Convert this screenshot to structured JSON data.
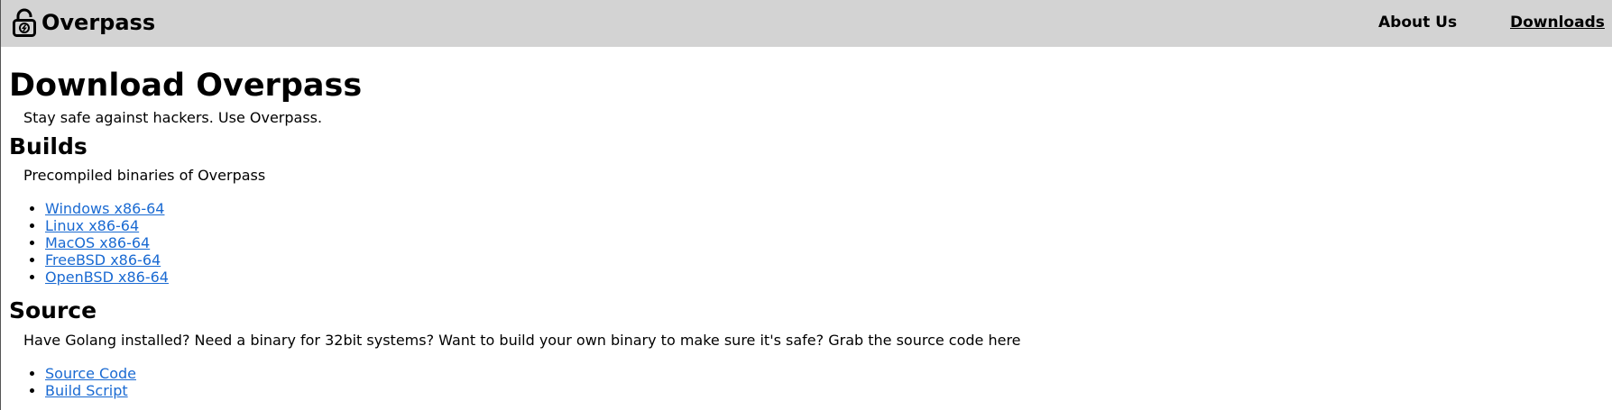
{
  "nav": {
    "brand": "Overpass",
    "links": [
      {
        "label": "About Us"
      },
      {
        "label": "Downloads"
      }
    ]
  },
  "main": {
    "title": "Download Overpass",
    "subtitle": "Stay safe against hackers. Use Overpass.",
    "builds": {
      "heading": "Builds",
      "description": "Precompiled binaries of Overpass",
      "links": [
        "Windows x86-64",
        "Linux x86-64",
        "MacOS x86-64",
        "FreeBSD x86-64",
        "OpenBSD x86-64"
      ]
    },
    "source": {
      "heading": "Source",
      "description": "Have Golang installed? Need a binary for 32bit systems? Want to build your own binary to make sure it's safe? Grab the source code here",
      "links": [
        "Source Code",
        "Build Script"
      ]
    }
  },
  "colors": {
    "navbar_bg": "#d3d3d3",
    "link": "#1a6ad2"
  },
  "icons": {
    "brand": "lock-icon"
  }
}
